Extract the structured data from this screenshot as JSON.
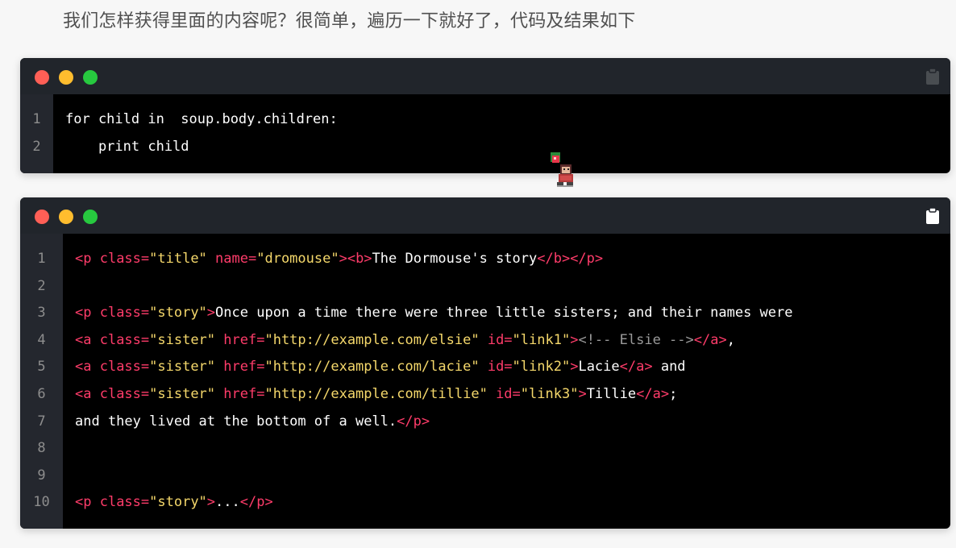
{
  "intro_text": "我们怎样获得里面的内容呢？很简单，遍历一下就好了，代码及结果如下",
  "colors": {
    "window_bar": "#21252b",
    "code_bg": "#000000",
    "gutter_bg": "#24272e",
    "tag": "#ff3c6a",
    "string": "#f5d86b",
    "comment": "#9a9a9a",
    "dot_red": "#ff5f56",
    "dot_yellow": "#ffbd2e",
    "dot_green": "#27c93f"
  },
  "icons": {
    "copy": "clipboard-icon",
    "mascot": "pixel-character-mascot"
  },
  "blocks": [
    {
      "line_numbers": [
        "1",
        "2"
      ],
      "lines": [
        [
          {
            "t": "kw",
            "v": "for child in  soup.body.children:"
          }
        ],
        [
          {
            "t": "kw",
            "v": "    print child"
          }
        ]
      ]
    },
    {
      "line_numbers": [
        "1",
        "2",
        "3",
        "4",
        "5",
        "6",
        "7",
        "8",
        "9",
        "10"
      ],
      "lines": [
        [
          {
            "t": "tag",
            "v": "<p "
          },
          {
            "t": "attr",
            "v": "class="
          },
          {
            "t": "str",
            "v": "\"title\""
          },
          {
            "t": "txt",
            "v": " "
          },
          {
            "t": "attr",
            "v": "name="
          },
          {
            "t": "str",
            "v": "\"dromouse\""
          },
          {
            "t": "tag",
            "v": "><b>"
          },
          {
            "t": "txt",
            "v": "The Dormouse's story"
          },
          {
            "t": "tag",
            "v": "</b></p>"
          }
        ],
        [],
        [
          {
            "t": "tag",
            "v": "<p "
          },
          {
            "t": "attr",
            "v": "class="
          },
          {
            "t": "str",
            "v": "\"story\""
          },
          {
            "t": "tag",
            "v": ">"
          },
          {
            "t": "txt",
            "v": "Once upon a time there were three little sisters; and their names were"
          }
        ],
        [
          {
            "t": "tag",
            "v": "<a "
          },
          {
            "t": "attr",
            "v": "class="
          },
          {
            "t": "str",
            "v": "\"sister\""
          },
          {
            "t": "txt",
            "v": " "
          },
          {
            "t": "attr",
            "v": "href="
          },
          {
            "t": "str",
            "v": "\"http://example.com/elsie\""
          },
          {
            "t": "txt",
            "v": " "
          },
          {
            "t": "attr",
            "v": "id="
          },
          {
            "t": "str",
            "v": "\"link1\""
          },
          {
            "t": "tag",
            "v": ">"
          },
          {
            "t": "cmt",
            "v": "<!-- Elsie -->"
          },
          {
            "t": "tag",
            "v": "</a>"
          },
          {
            "t": "txt",
            "v": ","
          }
        ],
        [
          {
            "t": "tag",
            "v": "<a "
          },
          {
            "t": "attr",
            "v": "class="
          },
          {
            "t": "str",
            "v": "\"sister\""
          },
          {
            "t": "txt",
            "v": " "
          },
          {
            "t": "attr",
            "v": "href="
          },
          {
            "t": "str",
            "v": "\"http://example.com/lacie\""
          },
          {
            "t": "txt",
            "v": " "
          },
          {
            "t": "attr",
            "v": "id="
          },
          {
            "t": "str",
            "v": "\"link2\""
          },
          {
            "t": "tag",
            "v": ">"
          },
          {
            "t": "txt",
            "v": "Lacie"
          },
          {
            "t": "tag",
            "v": "</a>"
          },
          {
            "t": "txt",
            "v": " and"
          }
        ],
        [
          {
            "t": "tag",
            "v": "<a "
          },
          {
            "t": "attr",
            "v": "class="
          },
          {
            "t": "str",
            "v": "\"sister\""
          },
          {
            "t": "txt",
            "v": " "
          },
          {
            "t": "attr",
            "v": "href="
          },
          {
            "t": "str",
            "v": "\"http://example.com/tillie\""
          },
          {
            "t": "txt",
            "v": " "
          },
          {
            "t": "attr",
            "v": "id="
          },
          {
            "t": "str",
            "v": "\"link3\""
          },
          {
            "t": "tag",
            "v": ">"
          },
          {
            "t": "txt",
            "v": "Tillie"
          },
          {
            "t": "tag",
            "v": "</a>"
          },
          {
            "t": "txt",
            "v": ";"
          }
        ],
        [
          {
            "t": "txt",
            "v": "and they lived at the bottom of a well."
          },
          {
            "t": "tag",
            "v": "</p>"
          }
        ],
        [],
        [],
        [
          {
            "t": "tag",
            "v": "<p "
          },
          {
            "t": "attr",
            "v": "class="
          },
          {
            "t": "str",
            "v": "\"story\""
          },
          {
            "t": "tag",
            "v": ">"
          },
          {
            "t": "txt",
            "v": "..."
          },
          {
            "t": "tag",
            "v": "</p>"
          }
        ]
      ]
    }
  ]
}
